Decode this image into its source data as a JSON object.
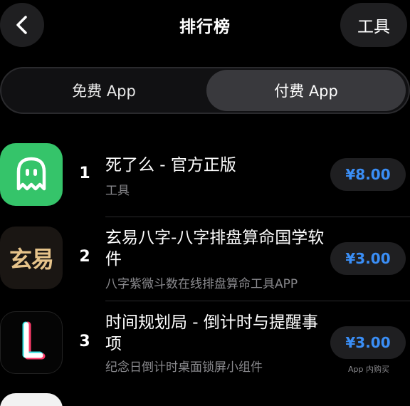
{
  "header": {
    "title": "排行榜",
    "tools_label": "工具"
  },
  "tabs": [
    {
      "label": "免费 App",
      "selected": false
    },
    {
      "label": "付费 App",
      "selected": true
    }
  ],
  "apps": [
    {
      "rank": "1",
      "name": "死了么 - 官方正版",
      "subtitle": "工具",
      "price": "¥8.00",
      "icon": "ghost-icon",
      "icon_color": "#35c46a"
    },
    {
      "rank": "2",
      "name": "玄易八字-八字排盘算命国学软件",
      "subtitle": "八字紫微斗数在线排盘算命工具APP",
      "price": "¥3.00",
      "icon": "xuanyi-logo",
      "icon_text": "玄易",
      "icon_text_color": "#e6c38a"
    },
    {
      "rank": "3",
      "name": "时间规划局 - 倒计时与提醒事项",
      "subtitle": "纪念日倒计时桌面锁屏小组件",
      "price": "¥3.00",
      "iap_note": "App 内购买",
      "icon": "clock-l-icon"
    }
  ],
  "colors": {
    "accent": "#3a8ef6",
    "background": "#000000"
  }
}
